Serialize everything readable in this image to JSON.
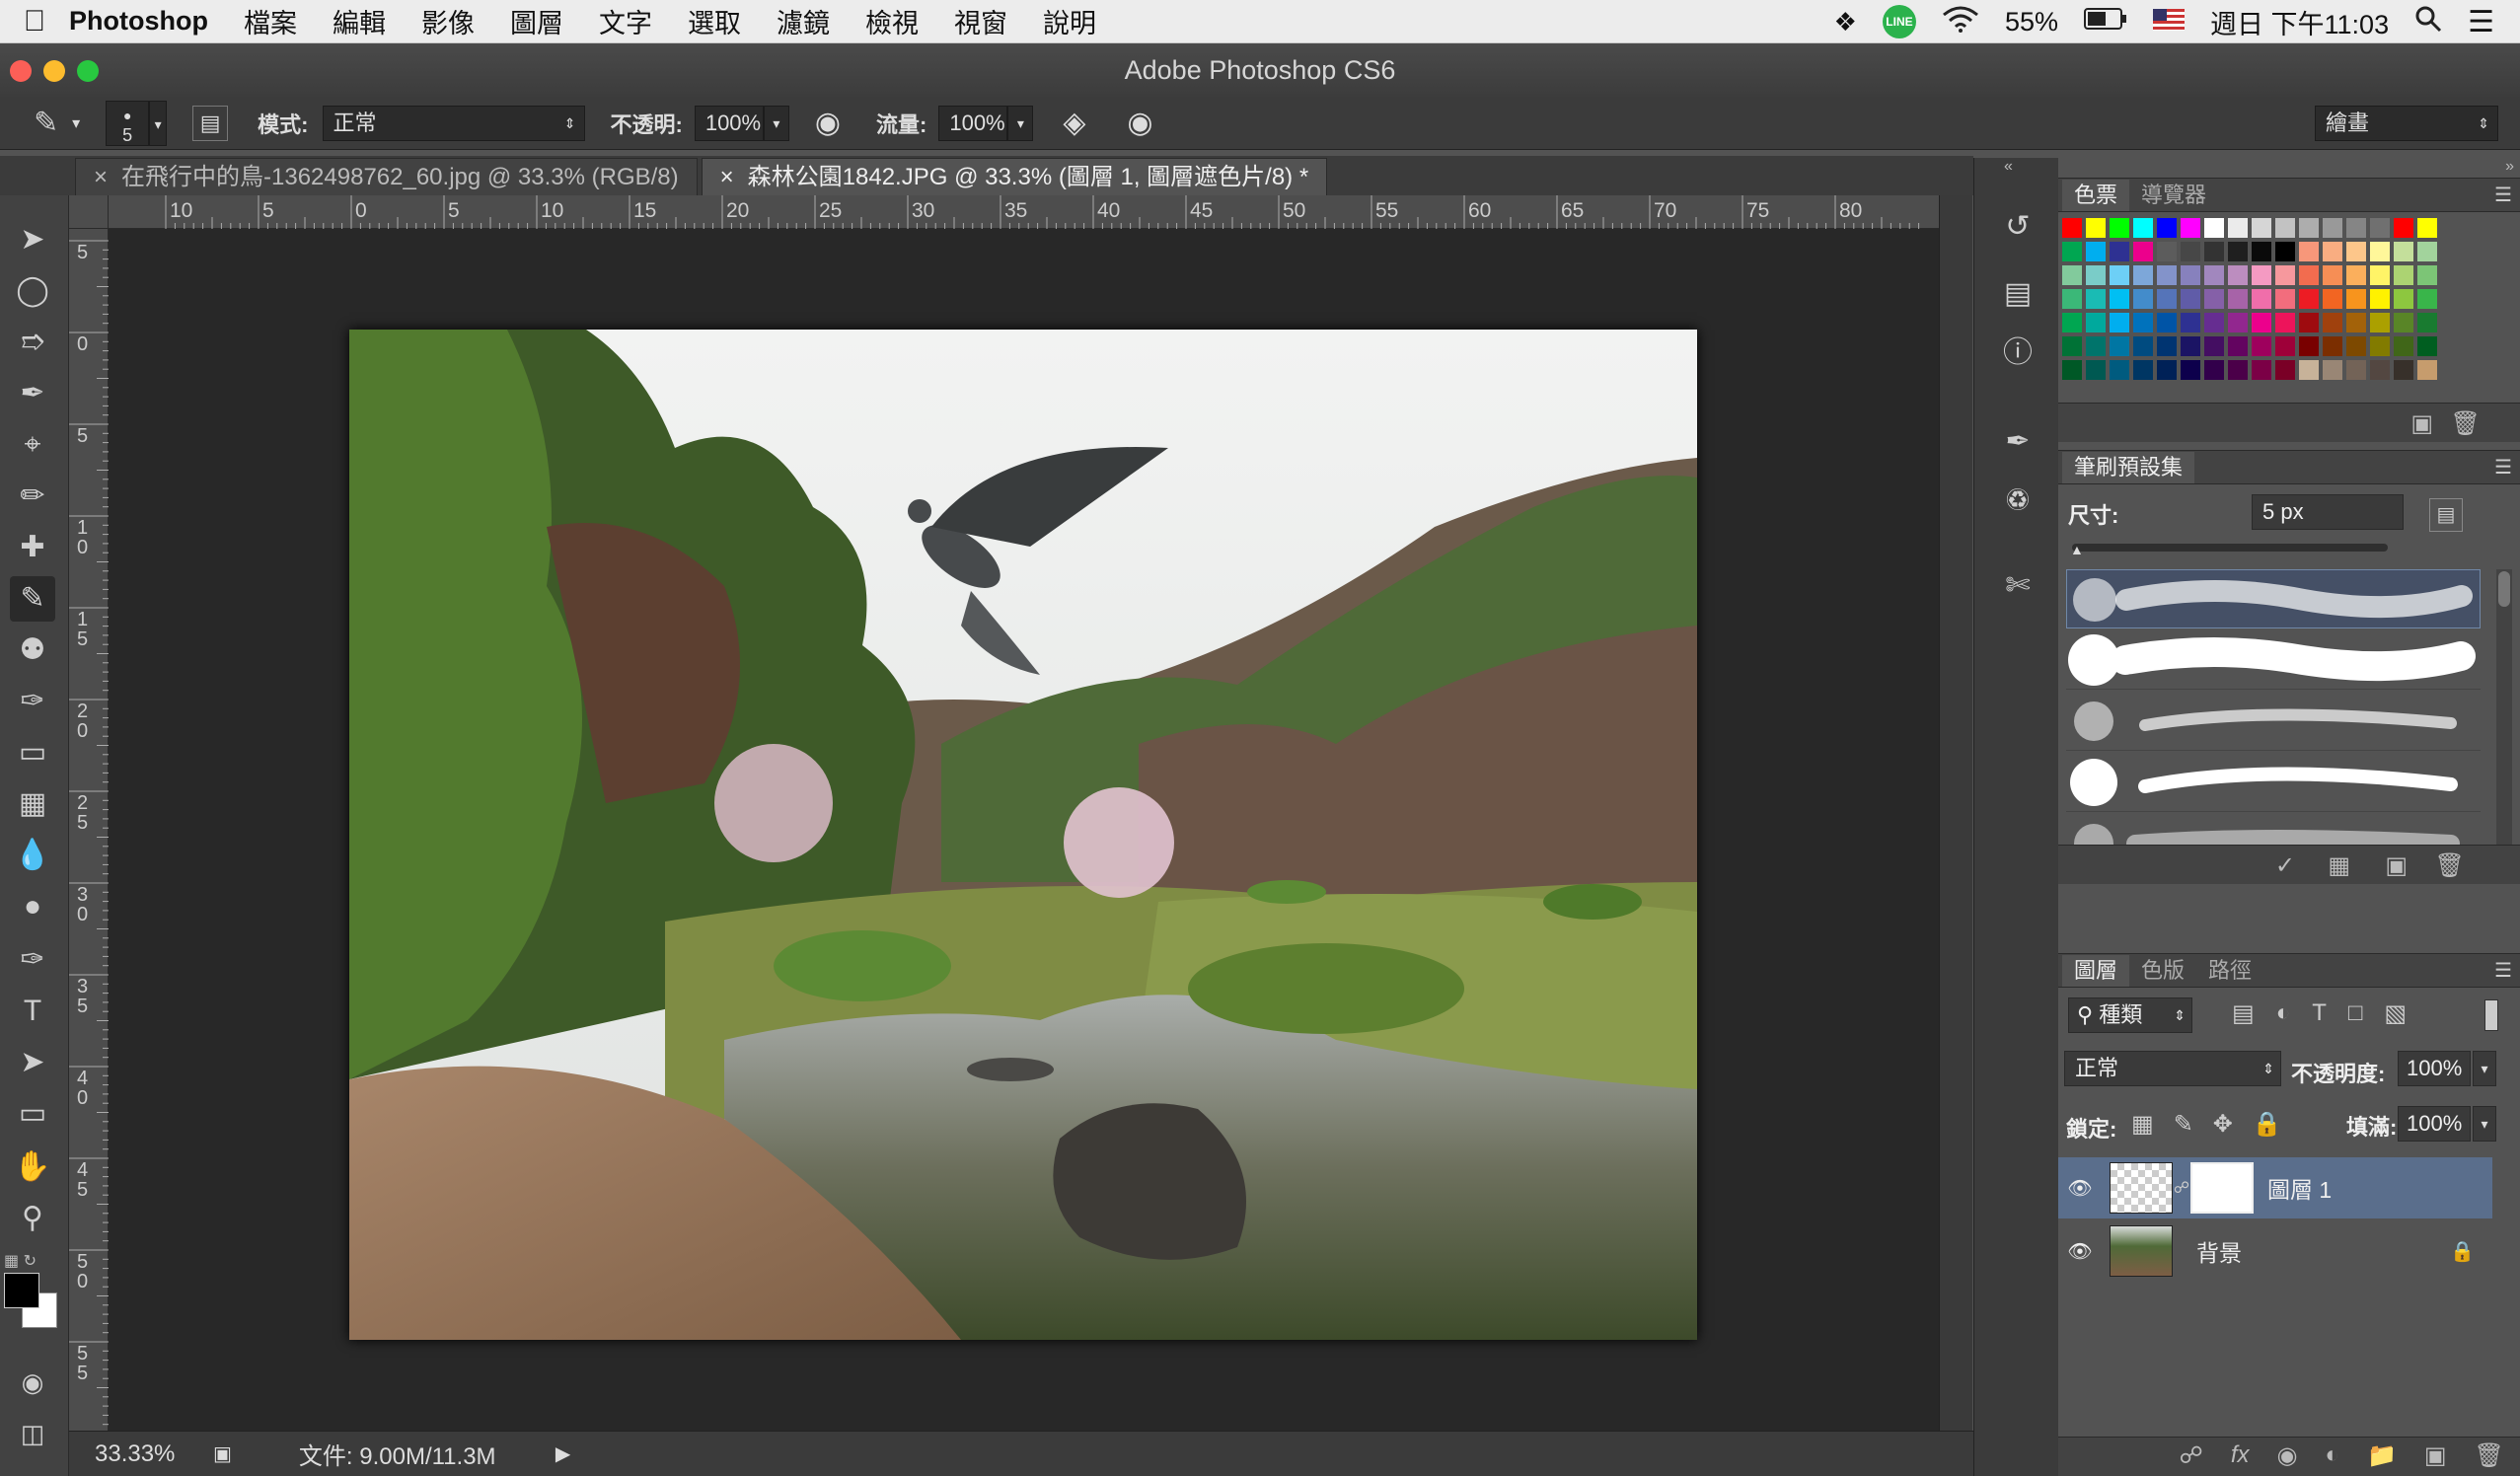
{
  "menubar": {
    "apple": "",
    "app": "Photoshop",
    "items": [
      "檔案",
      "編輯",
      "影像",
      "圖層",
      "文字",
      "選取",
      "濾鏡",
      "檢視",
      "視窗",
      "說明"
    ],
    "battery": "55%",
    "clock": "週日 下午11:03"
  },
  "window": {
    "title": "Adobe Photoshop CS6"
  },
  "options": {
    "brush_size": "5",
    "mode_label": "模式:",
    "mode_value": "正常",
    "opacity_label": "不透明:",
    "opacity_value": "100%",
    "flow_label": "流量:",
    "flow_value": "100%",
    "workspace": "繪畫"
  },
  "tabs": [
    {
      "label": "在飛行中的鳥-1362498762_60.jpg @ 33.3% (RGB/8)",
      "close": "×"
    },
    {
      "label": "森林公園1842.JPG @ 33.3% (圖層 1, 圖層遮色片/8) *",
      "close": "×"
    }
  ],
  "ruler": {
    "h": [
      "10",
      "5",
      "0",
      "5",
      "10",
      "15",
      "20",
      "25",
      "30",
      "35",
      "40",
      "45",
      "50",
      "55",
      "60",
      "65",
      "70",
      "75",
      "80"
    ],
    "v": [
      "5",
      "0",
      "5",
      "1\n0",
      "1\n5",
      "2\n0",
      "2\n5",
      "3\n0",
      "3\n5",
      "4\n0",
      "4\n5",
      "5\n0",
      "5\n5"
    ]
  },
  "status": {
    "zoom": "33.33%",
    "doc": "文件: 9.00M/11.3M"
  },
  "swatches_panel": {
    "tabs": [
      "色票",
      "導覽器"
    ]
  },
  "brush_panel": {
    "title": "筆刷預設集",
    "size_label": "尺寸:",
    "size_value": "5 px"
  },
  "layers_panel": {
    "tabs": [
      "圖層",
      "色版",
      "路徑"
    ],
    "kind": "種類",
    "blend": "正常",
    "opacity_label": "不透明度:",
    "opacity_value": "100%",
    "lock_label": "鎖定:",
    "fill_label": "填滿:",
    "fill_value": "100%",
    "layers": [
      {
        "name": "圖層 1"
      },
      {
        "name": "背景"
      }
    ]
  },
  "colors": {
    "accent": "#5a6e8c",
    "swatch_rows": [
      [
        "#ff0000",
        "#ffff00",
        "#00ff00",
        "#00ffff",
        "#0000ff",
        "#ff00ff",
        "#ffffff",
        "#ebebeb",
        "#d6d6d6",
        "#c2c2c2",
        "#adadad",
        "#999999",
        "#858585",
        "#707070",
        "#ff0000",
        "#ffff00"
      ],
      [
        "#00a651",
        "#00aeef",
        "#2e3192",
        "#ec008c",
        "#5c5c5c",
        "#474747",
        "#333333",
        "#1f1f1f",
        "#0a0a0a",
        "#000000",
        "#f7977a",
        "#f9ad81",
        "#fdc68a",
        "#fff79a",
        "#c4df9b",
        "#a2d39c"
      ],
      [
        "#82ca9c",
        "#7accc8",
        "#6dcff6",
        "#7da7d9",
        "#8393ca",
        "#8781bd",
        "#a187be",
        "#bc8dbf",
        "#f49ac2",
        "#f6989d",
        "#f26c4f",
        "#f68e55",
        "#fbaf5c",
        "#fff467",
        "#acd372",
        "#7cc576"
      ],
      [
        "#3bb878",
        "#1abbb4",
        "#00bff3",
        "#438ccb",
        "#5574b9",
        "#605ca8",
        "#8560a8",
        "#a763a8",
        "#f06eaa",
        "#f26d7d",
        "#ed1c24",
        "#f26522",
        "#f7941d",
        "#fff200",
        "#8dc73f",
        "#39b54a"
      ],
      [
        "#00a651",
        "#00a99d",
        "#00aeef",
        "#0072bc",
        "#0054a6",
        "#2e3192",
        "#662d91",
        "#92278f",
        "#ec008c",
        "#ed145b",
        "#9e0b0f",
        "#a0410d",
        "#a36209",
        "#aba000",
        "#598527",
        "#197b30"
      ],
      [
        "#007236",
        "#00746b",
        "#0076a3",
        "#004b80",
        "#003471",
        "#1b1464",
        "#440e62",
        "#630460",
        "#9e005d",
        "#9e0039",
        "#790000",
        "#7b2e00",
        "#7d4900",
        "#827b00",
        "#406618",
        "#005e20"
      ],
      [
        "#005826",
        "#005952",
        "#005b7f",
        "#003663",
        "#002157",
        "#0d004c",
        "#32004b",
        "#4b0049",
        "#7b0046",
        "#7a0026",
        "#c7b299",
        "#998675",
        "#736357",
        "#534741",
        "#37302a",
        "#c69c6d"
      ]
    ]
  }
}
